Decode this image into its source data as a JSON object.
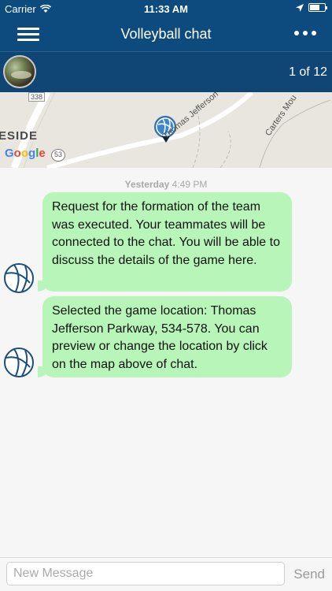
{
  "status_bar": {
    "carrier": "Carrier",
    "time": "11:33 AM"
  },
  "header": {
    "title": "Volleyball chat",
    "menu_icon": "hamburger-menu-icon",
    "more_icon": "more-dots-icon"
  },
  "info_bar": {
    "counter": "1 of 12"
  },
  "map": {
    "area_label": "ESIDE",
    "logo_text": "Google",
    "route_badge": "53",
    "route_badge_top": "338",
    "road_label_1": "Thomas Jefferson",
    "road_label_2": "Carters Mou"
  },
  "chat": {
    "date_label": "Yesterday",
    "date_time": "4:49 PM",
    "messages": [
      {
        "text": "Request for the formation of the team was executed. Your teammates will be connected to the chat. You will be able to discuss the details of the game here."
      },
      {
        "text": "Selected the game location: Thomas Jefferson Parkway, 534-578. You can preview or change the location by click on the map above of chat."
      }
    ]
  },
  "composer": {
    "placeholder": "New Message",
    "send_label": "Send"
  },
  "colors": {
    "nav": "#0d4a7e",
    "bubble": "#b8f5b8",
    "pin": "#3b86cc"
  }
}
